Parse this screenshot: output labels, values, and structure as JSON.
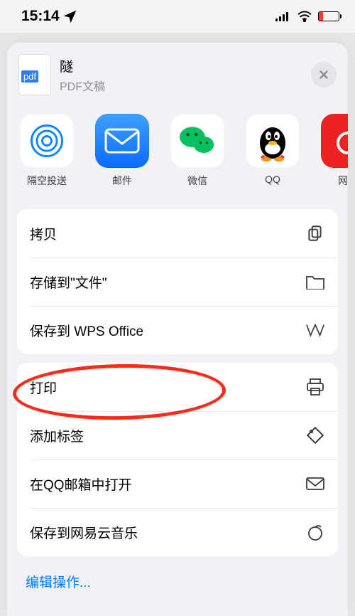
{
  "status": {
    "time": "15:14",
    "location_arrow": "↗",
    "signal": "5-dot",
    "wifi": true,
    "battery_low": true
  },
  "file": {
    "ext": "pdf",
    "title": "隧",
    "subtitle": "PDF文稿"
  },
  "apps": [
    {
      "id": "airdrop",
      "label": "隔空投送"
    },
    {
      "id": "mail",
      "label": "邮件"
    },
    {
      "id": "wechat",
      "label": "微信"
    },
    {
      "id": "qq",
      "label": "QQ"
    },
    {
      "id": "netease",
      "label": "网易"
    }
  ],
  "group1": [
    {
      "id": "copy",
      "label": "拷贝",
      "icon": "copy-icon"
    },
    {
      "id": "save-files",
      "label": "存储到\"文件\"",
      "icon": "folder-icon"
    },
    {
      "id": "save-wps",
      "label": "保存到 WPS Office",
      "icon": "wps-icon"
    }
  ],
  "group2": [
    {
      "id": "print",
      "label": "打印",
      "icon": "printer-icon"
    },
    {
      "id": "add-tags",
      "label": "添加标签",
      "icon": "tag-icon"
    },
    {
      "id": "open-qqmail",
      "label": "在QQ邮箱中打开",
      "icon": "mail-icon"
    },
    {
      "id": "save-netease",
      "label": "保存到网易云音乐",
      "icon": "netease-icon"
    }
  ],
  "editActions": "编辑操作...",
  "highlighted_action_id": "print"
}
